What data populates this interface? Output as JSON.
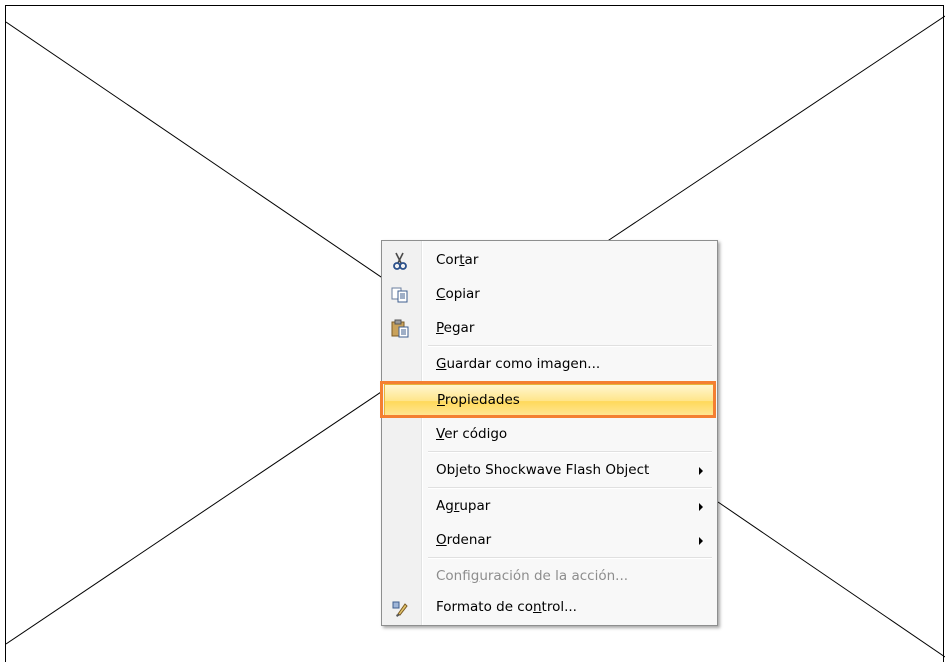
{
  "menu": {
    "items": [
      {
        "id": "cortar",
        "pre": "Cor",
        "acc": "t",
        "post": "ar",
        "icon": "scissors-icon",
        "submenu": false,
        "disabled": false,
        "selected": false
      },
      {
        "id": "copiar",
        "pre": "",
        "acc": "C",
        "post": "opiar",
        "icon": "copy-icon",
        "submenu": false,
        "disabled": false,
        "selected": false
      },
      {
        "id": "pegar",
        "pre": "",
        "acc": "P",
        "post": "egar",
        "icon": "paste-icon",
        "submenu": false,
        "disabled": false,
        "selected": false
      },
      {
        "id": "guardar-como-imagen",
        "pre": "",
        "acc": "G",
        "post": "uardar como imagen...",
        "icon": "",
        "submenu": false,
        "disabled": false,
        "selected": false
      },
      {
        "id": "propiedades",
        "pre": "",
        "acc": "P",
        "post": "ropiedades",
        "icon": "",
        "submenu": false,
        "disabled": false,
        "selected": true
      },
      {
        "id": "ver-codigo",
        "pre": "",
        "acc": "V",
        "post": "er código",
        "icon": "",
        "submenu": false,
        "disabled": false,
        "selected": false
      },
      {
        "id": "objeto-shockwave",
        "pre": "Ob",
        "acc": "j",
        "post": "eto Shockwave Flash Object",
        "icon": "",
        "submenu": true,
        "disabled": false,
        "selected": false
      },
      {
        "id": "agrupar",
        "pre": "Ag",
        "acc": "r",
        "post": "upar",
        "icon": "",
        "submenu": true,
        "disabled": false,
        "selected": false
      },
      {
        "id": "ordenar",
        "pre": "",
        "acc": "O",
        "post": "rdenar",
        "icon": "",
        "submenu": true,
        "disabled": false,
        "selected": false
      },
      {
        "id": "configuracion-accion",
        "pre": "Confi",
        "acc": "g",
        "post": "uración de la acción...",
        "icon": "",
        "submenu": false,
        "disabled": true,
        "selected": false
      },
      {
        "id": "formato-control",
        "pre": "Formato de co",
        "acc": "n",
        "post": "trol...",
        "icon": "format-control-icon",
        "submenu": false,
        "disabled": false,
        "selected": false
      }
    ]
  },
  "colors": {
    "highlight_border": "#f47f32",
    "selected_fill": "#ffe58a",
    "menu_border": "#8e8f8f"
  }
}
